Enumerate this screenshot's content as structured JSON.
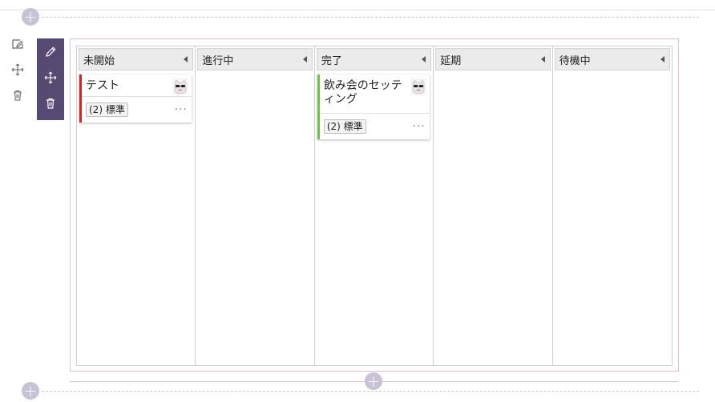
{
  "board": {
    "columns": [
      {
        "title": "未開始",
        "cards": [
          {
            "title": "テスト",
            "badge": "(2) 標準",
            "accent": "#e02020"
          }
        ]
      },
      {
        "title": "進行中",
        "cards": []
      },
      {
        "title": "完了",
        "cards": [
          {
            "title": "飲み会のセッティング",
            "badge": "(2) 標準",
            "accent": "#6fc24a"
          }
        ]
      },
      {
        "title": "延期",
        "cards": []
      },
      {
        "title": "待機中",
        "cards": []
      }
    ]
  },
  "icons": {
    "side": [
      "edit-section-icon",
      "move-section-icon",
      "delete-section-icon"
    ],
    "toolbar": [
      "pencil-icon",
      "move-icon",
      "trash-icon"
    ],
    "add": "plus-icon",
    "more": "ellipsis-icon"
  },
  "more_label": "···",
  "colors": {
    "toolbar": "#564a72",
    "frame": "#e5bcc8",
    "add_circle": "#c8c2d6"
  }
}
